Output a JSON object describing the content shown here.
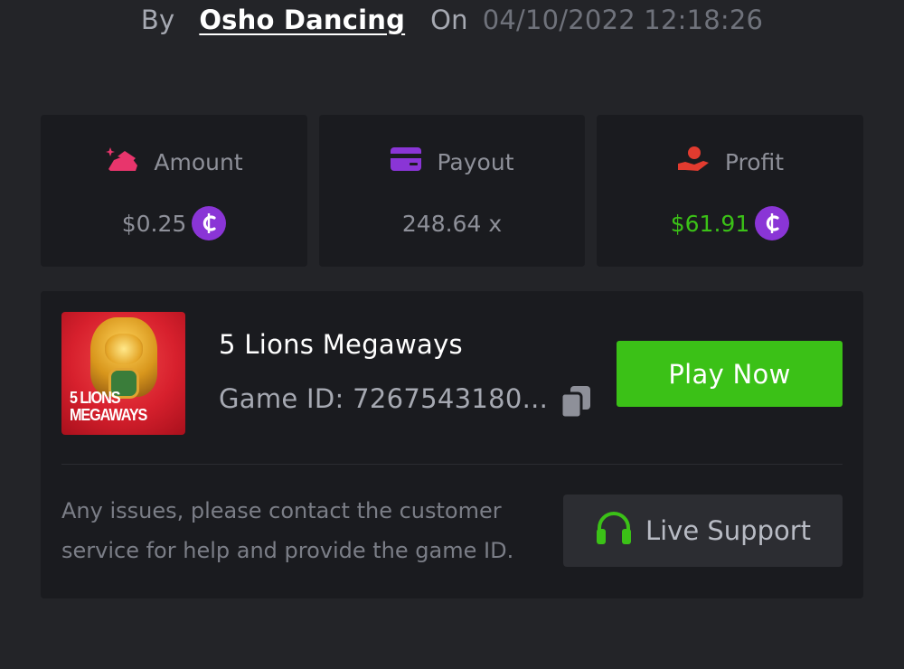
{
  "byline": {
    "by_label": "By",
    "username": "Osho Dancing",
    "on_label": "On",
    "datetime": "04/10/2022 12:18:26"
  },
  "stats": {
    "amount": {
      "label": "Amount",
      "value": "$0.25",
      "icon": "bet-amount-icon",
      "icon_color": "#e8356c"
    },
    "payout": {
      "label": "Payout",
      "value": "248.64 x",
      "icon": "card-icon",
      "icon_color": "#8a35d6"
    },
    "profit": {
      "label": "Profit",
      "value": "$61.91",
      "icon": "hand-coin-icon",
      "icon_color": "#e23b2f",
      "value_color": "#3bc117"
    }
  },
  "currency": {
    "symbol": "₵",
    "color": "#8a35d6"
  },
  "game": {
    "title": "5 Lions Megaways",
    "id_label": "Game ID:",
    "id_value": "7267543180...",
    "id_text": "Game ID: 7267543180...",
    "thumbnail_logo_line1": "5 LIONS",
    "thumbnail_logo_line2": "MEGAWAYS",
    "play_label": "Play Now"
  },
  "support": {
    "help_text": "Any issues, please contact the customer service for help and provide the game ID.",
    "button_label": "Live Support"
  },
  "colors": {
    "background": "#232428",
    "card": "#1a1b1f",
    "accent_green": "#3bc117"
  }
}
